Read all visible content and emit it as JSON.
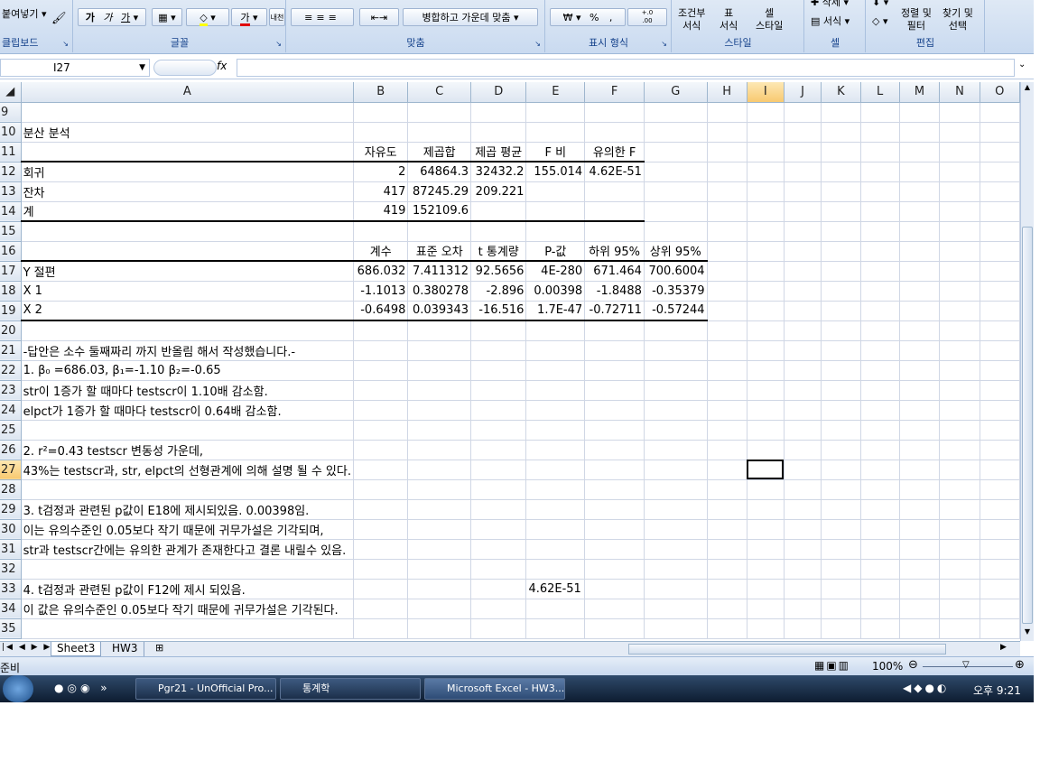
{
  "ribbon": {
    "clipboard": {
      "paste_label": "붙여넣기",
      "group_label": "클립보드"
    },
    "font": {
      "bold": "가",
      "italic": "가",
      "underline": "가",
      "group_label": "글꼴",
      "font_color_glyph": "가",
      "phonetic": "내천"
    },
    "alignment": {
      "merge_center": "병합하고 가운데 맞춤",
      "group_label": "맞춤"
    },
    "number": {
      "currency": "₩",
      "percent": "%",
      "comma": ",",
      "inc_decimal": "+.0 .00",
      "dec_decimal": ".00 +.0",
      "group_label": "표시 형식"
    },
    "styles": {
      "conditional": "조건부\n서식",
      "table_format": "표\n서식",
      "cell_style": "셀\n스타일",
      "group_label": "스타일"
    },
    "cells": {
      "delete": "삭제",
      "format": "서식",
      "group_label": "셀"
    },
    "editing": {
      "sort_filter": "정렬 및\n필터",
      "find_select": "찾기 및\n선택",
      "group_label": "편집"
    }
  },
  "formula_bar": {
    "name_box": "I27",
    "fx": "fx",
    "formula": ""
  },
  "columns": [
    "A",
    "B",
    "C",
    "D",
    "E",
    "F",
    "G",
    "H",
    "I",
    "J",
    "K",
    "L",
    "M",
    "N",
    "O"
  ],
  "selected_column": "I",
  "selected_row": "27",
  "rows": [
    {
      "n": "9",
      "cells": {}
    },
    {
      "n": "10",
      "cells": {
        "A": "분산 분석"
      }
    },
    {
      "n": "11",
      "cells": {
        "B": "자유도",
        "C": "제곱합",
        "D": "제곱 평균",
        "E": "F 비",
        "F": "유의한 F"
      }
    },
    {
      "n": "12",
      "cells": {
        "A": "회귀",
        "B": "2",
        "C": "64864.3",
        "D": "32432.2",
        "E": "155.014",
        "F": "4.62E-51"
      }
    },
    {
      "n": "13",
      "cells": {
        "A": "잔차",
        "B": "417",
        "C": "87245.29",
        "D": "209.221"
      }
    },
    {
      "n": "14",
      "cells": {
        "A": "계",
        "B": "419",
        "C": "152109.6"
      }
    },
    {
      "n": "15",
      "cells": {}
    },
    {
      "n": "16",
      "cells": {
        "B": "계수",
        "C": "표준 오차",
        "D": "t 통계량",
        "E": "P-값",
        "F": "하위 95%",
        "G": "상위 95%"
      }
    },
    {
      "n": "17",
      "cells": {
        "A": "Y 절편",
        "B": "686.032",
        "C": "7.411312",
        "D": "92.5656",
        "E": "4E-280",
        "F": "671.464",
        "G": "700.6004"
      }
    },
    {
      "n": "18",
      "cells": {
        "A": "X 1",
        "B": "-1.1013",
        "C": "0.380278",
        "D": "-2.896",
        "E": "0.00398",
        "F": "-1.8488",
        "G": "-0.35379"
      }
    },
    {
      "n": "19",
      "cells": {
        "A": "X 2",
        "B": "-0.6498",
        "C": "0.039343",
        "D": "-16.516",
        "E": "1.7E-47",
        "F": "-0.72711",
        "G": "-0.57244"
      }
    },
    {
      "n": "20",
      "cells": {}
    },
    {
      "n": "21",
      "cells": {
        "A": " -답안은 소수 둘째짜리 까지 반올림 해서 작성했습니다.-"
      }
    },
    {
      "n": "22",
      "cells": {
        "A": "1. β₀ =686.03, β₁=-1.10 β₂=-0.65"
      }
    },
    {
      "n": "23",
      "cells": {
        "A": "  str이 1증가 할 때마다 testscr이 1.10배 감소함."
      }
    },
    {
      "n": "24",
      "cells": {
        "A": "  elpct가 1증가 할 때마다 testscr이 0.64배 감소함."
      }
    },
    {
      "n": "25",
      "cells": {}
    },
    {
      "n": "26",
      "cells": {
        "A": "2. r²=0.43 testscr 변동성 가운데,"
      }
    },
    {
      "n": "27",
      "cells": {
        "A": "   43%는 testscr과, str, elpct의 선형관계에 의해 설명 될 수 있다."
      }
    },
    {
      "n": "28",
      "cells": {}
    },
    {
      "n": "29",
      "cells": {
        "A": "3.  t검정과 관련된 p값이 E18에 제시되있음. 0.00398임."
      }
    },
    {
      "n": "30",
      "cells": {
        "A": "  이는 유의수준인 0.05보다 작기 때문에  귀무가설은 기각되며,"
      }
    },
    {
      "n": "31",
      "cells": {
        "A": "  str과 testscr간에는 유의한 관계가 존재한다고 결론 내릴수 있음."
      }
    },
    {
      "n": "32",
      "cells": {}
    },
    {
      "n": "33",
      "cells": {
        "A": "4. t검정과 관련된 p값이 F12에 제시 되있음.",
        "E": "4.62E-51"
      }
    },
    {
      "n": "34",
      "cells": {
        "A": "  이 값은 유의수준인 0.05보다 작기 때문에 귀무가설은 기각된다."
      }
    },
    {
      "n": "35",
      "cells": {}
    }
  ],
  "sheet_tabs": [
    "Sheet3",
    "HW3"
  ],
  "status": {
    "ready": "준비",
    "zoom": "100%"
  },
  "taskbar": {
    "items": [
      "Pgr21 - UnOfficial Pro...",
      "통계학",
      "Microsoft Excel - HW3..."
    ],
    "clock": "오후 9:21"
  }
}
